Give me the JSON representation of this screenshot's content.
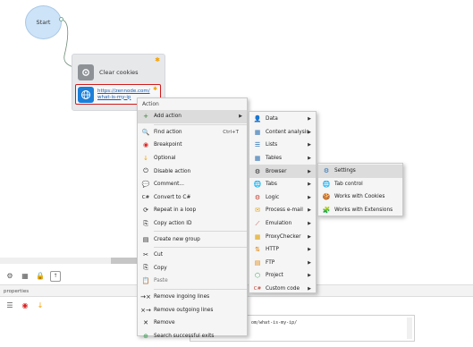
{
  "canvas": {
    "start_label": "Start",
    "block_title": "Clear cookies",
    "url_line1": "https://zennode.com/",
    "url_line2": "what-is-my-ip"
  },
  "bottom": {
    "tab_label": "properties",
    "url_value": "om/what-is-my-ip/"
  },
  "context_menu": {
    "header": "Action",
    "items": [
      {
        "icon": "+",
        "label": "Add action",
        "shortcut": "",
        "submenu": true
      },
      {
        "icon": "🔍",
        "label": "Find action",
        "shortcut": "Ctrl+T",
        "submenu": false
      },
      {
        "icon": "◉",
        "label": "Breakpoint",
        "shortcut": "",
        "submenu": false
      },
      {
        "icon": "↓",
        "label": "Optional",
        "shortcut": "",
        "submenu": false
      },
      {
        "icon": "⏻",
        "label": "Disable action",
        "shortcut": "",
        "submenu": false
      },
      {
        "icon": "💬",
        "label": "Comment...",
        "shortcut": "",
        "submenu": false
      },
      {
        "icon": "C#",
        "label": "Convert to C#",
        "shortcut": "",
        "submenu": false
      },
      {
        "icon": "⟳",
        "label": "Repeat in a loop",
        "shortcut": "",
        "submenu": false
      },
      {
        "icon": "⎘",
        "label": "Copy action ID",
        "shortcut": "",
        "submenu": false
      },
      {
        "icon": "▤",
        "label": "Create new group",
        "shortcut": "",
        "submenu": false
      },
      {
        "icon": "✂",
        "label": "Cut",
        "shortcut": "",
        "submenu": false
      },
      {
        "icon": "⎘",
        "label": "Copy",
        "shortcut": "",
        "submenu": false
      },
      {
        "icon": "📋",
        "label": "Paste",
        "shortcut": "",
        "submenu": false
      },
      {
        "icon": "→×",
        "label": "Remove ingoing lines",
        "shortcut": "",
        "submenu": false
      },
      {
        "icon": "×→",
        "label": "Remove outgoing lines",
        "shortcut": "",
        "submenu": false
      },
      {
        "icon": "✕",
        "label": "Remove",
        "shortcut": "",
        "submenu": false
      },
      {
        "icon": "⊕",
        "label": "Search successful exits",
        "shortcut": "",
        "submenu": false
      }
    ],
    "submenu": [
      {
        "icon": "👤",
        "label": "Data"
      },
      {
        "icon": "▦",
        "label": "Content analysis"
      },
      {
        "icon": "☰",
        "label": "Lists"
      },
      {
        "icon": "▦",
        "label": "Tables"
      },
      {
        "icon": "⚙",
        "label": "Browser"
      },
      {
        "icon": "🌐",
        "label": "Tabs"
      },
      {
        "icon": "⚙",
        "label": "Logic"
      },
      {
        "icon": "✉",
        "label": "Process e-mail"
      },
      {
        "icon": "⟋",
        "label": "Emulation"
      },
      {
        "icon": "▦",
        "label": "ProxyChecker"
      },
      {
        "icon": "⇅",
        "label": "HTTP"
      },
      {
        "icon": "▤",
        "label": "FTP"
      },
      {
        "icon": "⬡",
        "label": "Project"
      },
      {
        "icon": "C#",
        "label": "Custom code"
      }
    ],
    "submenu2": [
      {
        "icon": "⚙",
        "label": "Settings"
      },
      {
        "icon": "🌐",
        "label": "Tab control"
      },
      {
        "icon": "🍪",
        "label": "Works with Cookies"
      },
      {
        "icon": "🧩",
        "label": "Works with Extensions"
      }
    ]
  },
  "colors": {
    "accent": "#1c7fd9",
    "start_fill": "#cde3f7",
    "highlight_border": "#d21b1b",
    "star": "#f4a000"
  }
}
